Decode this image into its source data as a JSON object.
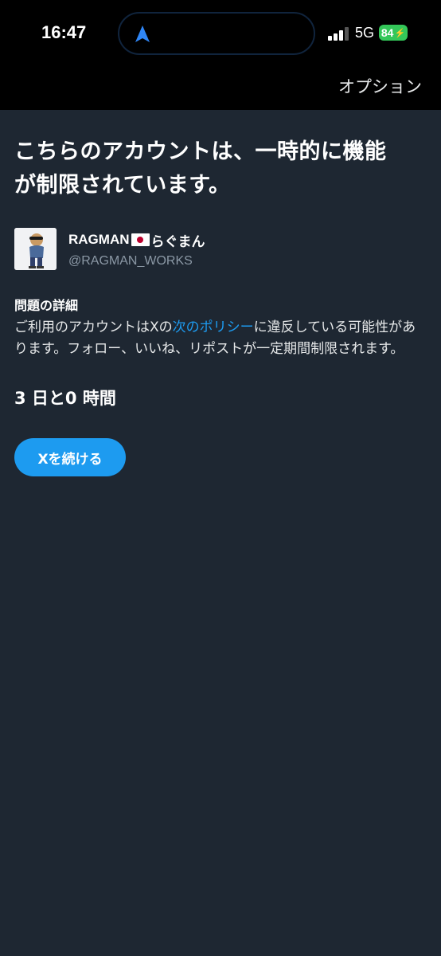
{
  "status_bar": {
    "time": "16:47",
    "network": "5G",
    "battery": "84",
    "battery_color": "#34c759",
    "location_icon": "navigation-arrow-icon"
  },
  "header": {
    "options_label": "オプション"
  },
  "notice": {
    "headline_line1": "こちらのアカウントは、一時的に機能",
    "headline_line2": "が制限されています。"
  },
  "account": {
    "name_prefix": "RAGMAN",
    "flag_icon": "japan-flag-icon",
    "name_suffix": "らぐまん",
    "handle": "@RAGMAN_WORKS"
  },
  "details": {
    "title": "問題の詳細",
    "text_before": "ご利用のアカウントはXの",
    "link_text": "次のポリシー",
    "text_after": "に違反している可能性があります。フォロー、いいね、リポストが一定期間制限されます。"
  },
  "countdown": "3 日と0 時間",
  "continue_button_label": "Xを続ける",
  "colors": {
    "background": "#1e2732",
    "accent": "#1d9bf0",
    "text_secondary": "#8b98a5"
  }
}
